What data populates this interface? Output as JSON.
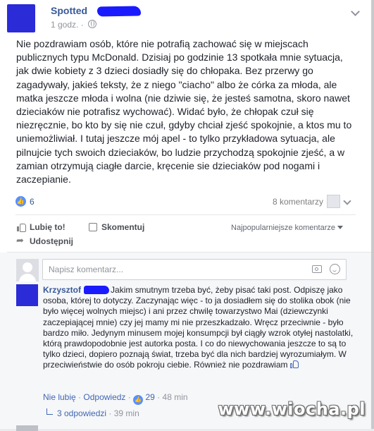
{
  "post": {
    "page_name": "Spotted",
    "time": "1 godz.",
    "text": "Nie pozdrawiam osób, które nie potrafią zachować się w miejscach publicznych typu McDonald. Dzisiaj po godzinie 13 spotkała mnie sytuacja, jak dwie kobiety z 3 dzieci dosiadły się do chłopaka. Bez przerwy go zagadywały, jakieś teksty, że z niego \"ciacho\" albo że córka za młoda, ale matka jeszcze młoda i wolna (nie dziwie się, że jesteś samotna, skoro nawet dzieciaków nie potrafisz wychować). Widać było, że chłopak czuł się niezręcznie, bo kto by się nie czuł, gdyby chciał zjeść spokojnie, a ktos mu to uniemożliwiał. I tutaj jeszcze mój apel - to tylko przykładowa sytuacja, ale pilnujcie tych swoich dzieciaków, bo ludzie przychodzą spokojnie zjeść, a w zamian otrzymują ciagłe darcie, kręcenie sie dzieciaków pod nogami i zaczepianie.",
    "likes": "6",
    "comments": "8 komentarzy"
  },
  "actions": {
    "like": "Lubię to!",
    "comment": "Skomentuj",
    "share": "Udostępnij",
    "sort": "Najpopularniejsze komentarze"
  },
  "composer": {
    "placeholder": "Napisz komentarz..."
  },
  "comment": {
    "author": "Krzysztof",
    "text": "Jakim smutnym trzeba być, żeby pisać taki post. Odpiszę jako osoba, której to dotyczy. Zaczynając więc - to ja dosiadłem się do stolika obok (nie było więcej wolnych miejsc) i ani przez chwilę towarzystwo Mai (dziewczynki zaczepiającej mnie) czy jej mamy mi nie przeszkadzało. Wręcz przeciwnie - było bardzo miło. Jedynym minusem mojej konsumpcji był ciągły wzrok otyłej nastolatki, którą prawdopodobnie jest autorka posta. I co do niewychowania jeszcze to są to tylko dzieci, dopiero poznają świat, trzeba być dla nich bardziej wyrozumiałym. W przeciwieństwie do osób pokroju ciebie. Również nie pozdrawiam",
    "unlike": "Nie lubię",
    "reply": "Odpowiedz",
    "likes": "29",
    "time": "48 min",
    "replies": "3 odpowiedzi",
    "replies_time": "39 min"
  },
  "watermark": "www.wiocha.pl",
  "colors": {
    "link": "#365899",
    "like_blue": "#5890ff",
    "redaction": "#1a1aff"
  }
}
